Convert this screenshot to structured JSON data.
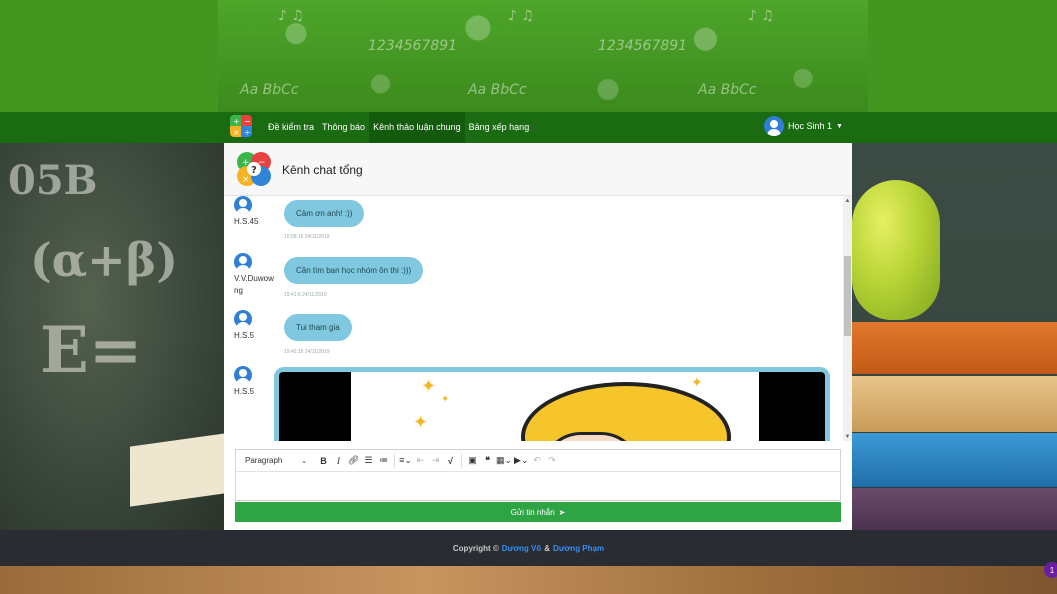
{
  "navbar": {
    "links": [
      "Đề kiểm tra",
      "Thông báo",
      "Kênh thảo luận chung",
      "Bảng xếp hạng"
    ],
    "active_index": 2,
    "user_name": "Học Sinh 1"
  },
  "channel": {
    "title": "Kênh chat tổng"
  },
  "messages": [
    {
      "user": "H.S.45",
      "text": "Cảm ơn anh! :))",
      "time": "10:58:16 24/11/2019"
    },
    {
      "user": "V.V.Duwowng",
      "text": "Cần tìm bạn học nhóm ôn thi :)))",
      "time": "19:41:6 24/11/2019"
    },
    {
      "user": "H.S.5",
      "text": "Tui tham gia",
      "time": "19:42:15 24/11/2019"
    },
    {
      "user": "H.S.5",
      "type": "image"
    }
  ],
  "editor": {
    "format_select": "Paragraph",
    "send_label": "Gửi tin nhắn"
  },
  "footer": {
    "prefix": "Copyright ©",
    "author1": "Dương Võ",
    "separator": "&",
    "author2": "Dương Phạm"
  },
  "notification_count": "1",
  "colors": {
    "banner": "#43961f",
    "navbar": "#1a6b12",
    "bubble": "#80c8df",
    "send_button": "#2ea444",
    "footer": "#2a2c33",
    "author_link": "#3a8ef0"
  }
}
